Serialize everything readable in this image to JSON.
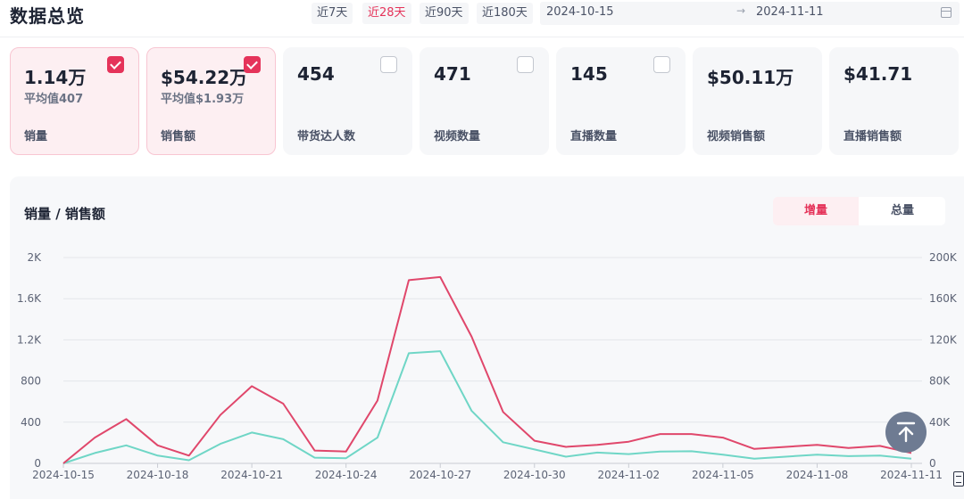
{
  "header": {
    "title": "数据总览",
    "ranges": [
      "近7天",
      "近28天",
      "近90天",
      "近180天"
    ],
    "active_range": 1,
    "start_date": "2024-10-15",
    "end_date": "2024-11-11",
    "date_separator": "→"
  },
  "cards": [
    {
      "value": "1.14万",
      "sub": "平均值407",
      "label": "销量",
      "checked": true
    },
    {
      "value": "$54.22万",
      "sub": "平均值$1.93万",
      "label": "销售额",
      "checked": true
    },
    {
      "value": "454",
      "sub": "",
      "label": "带货达人数",
      "checked": false
    },
    {
      "value": "471",
      "sub": "",
      "label": "视频数量",
      "checked": false
    },
    {
      "value": "145",
      "sub": "",
      "label": "直播数量",
      "checked": false
    },
    {
      "value": "$50.11万",
      "sub": "",
      "label": "视频销售额",
      "checked": null
    },
    {
      "value": "$41.71",
      "sub": "",
      "label": "直播销售额",
      "checked": null
    }
  ],
  "chart": {
    "title": "销量 / 销售额",
    "toggle": {
      "increment": "增量",
      "total": "总量"
    }
  },
  "chart_data": {
    "type": "line",
    "x": [
      "2024-10-15",
      "2024-10-16",
      "2024-10-17",
      "2024-10-18",
      "2024-10-19",
      "2024-10-20",
      "2024-10-21",
      "2024-10-22",
      "2024-10-23",
      "2024-10-24",
      "2024-10-25",
      "2024-10-26",
      "2024-10-27",
      "2024-10-28",
      "2024-10-29",
      "2024-10-30",
      "2024-10-31",
      "2024-11-01",
      "2024-11-02",
      "2024-11-03",
      "2024-11-04",
      "2024-11-05",
      "2024-11-06",
      "2024-11-07",
      "2024-11-08",
      "2024-11-09",
      "2024-11-10",
      "2024-11-11"
    ],
    "x_tick_labels": [
      "2024-10-15",
      "2024-10-18",
      "2024-10-21",
      "2024-10-24",
      "2024-10-27",
      "2024-10-30",
      "2024-11-02",
      "2024-11-05",
      "2024-11-08",
      "2024-11-11"
    ],
    "series": [
      {
        "axis": "left",
        "color": "#e0476b",
        "values": [
          0,
          250,
          430,
          175,
          75,
          470,
          750,
          580,
          125,
          115,
          610,
          1780,
          1810,
          1230,
          500,
          220,
          160,
          180,
          210,
          285,
          285,
          250,
          140,
          160,
          180,
          150,
          170,
          100
        ]
      },
      {
        "axis": "right",
        "color": "#6fd6c6",
        "values": [
          0,
          10000,
          17500,
          7500,
          3000,
          19000,
          30000,
          23500,
          5500,
          5000,
          25000,
          107000,
          109000,
          51000,
          20500,
          13500,
          6500,
          10500,
          9000,
          11500,
          11800,
          8500,
          4500,
          6500,
          8500,
          7000,
          7500,
          4500
        ]
      }
    ],
    "y_left": {
      "min": 0,
      "max": 2000,
      "ticks": [
        0,
        400,
        800,
        1200,
        1600,
        2000
      ],
      "tick_labels": [
        "0",
        "400",
        "800",
        "1.2K",
        "1.6K",
        "2K"
      ]
    },
    "y_right": {
      "min": 0,
      "max": 200000,
      "ticks": [
        0,
        40000,
        80000,
        120000,
        160000,
        200000
      ],
      "tick_labels": [
        "0",
        "40K",
        "80K",
        "120K",
        "160K",
        "200K"
      ]
    },
    "grid": true,
    "legend": "none"
  }
}
